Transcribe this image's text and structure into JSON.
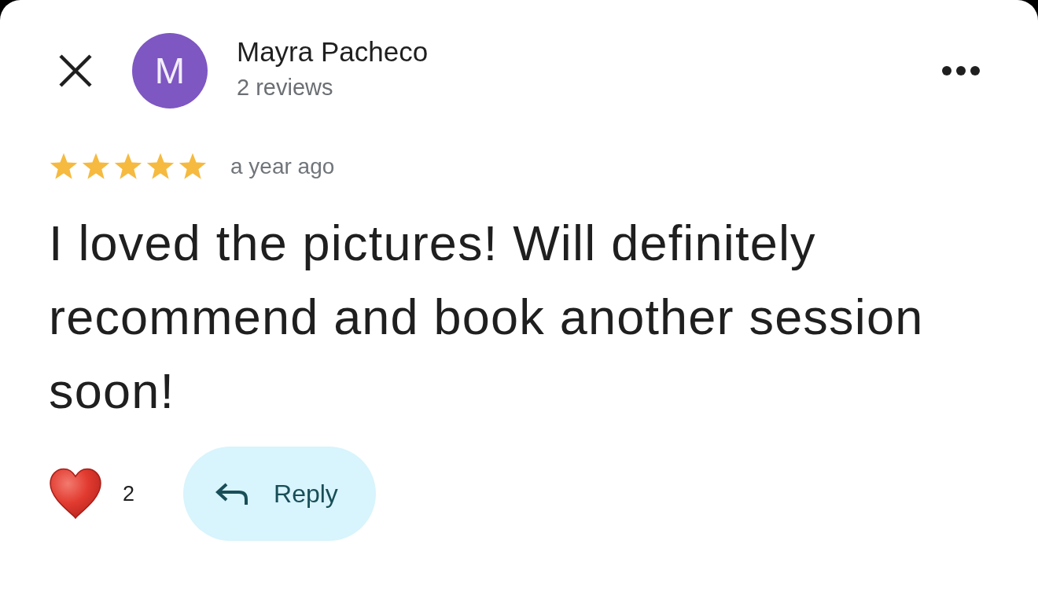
{
  "reviewer": {
    "initial": "M",
    "name": "Mayra Pacheco",
    "review_count": "2 reviews"
  },
  "review": {
    "stars": 5,
    "date": "a year ago",
    "text": "I loved the pictures! Will definitely recommend and book another session soon!"
  },
  "reactions": {
    "count": "2"
  },
  "reply_button": {
    "label": "Reply"
  }
}
